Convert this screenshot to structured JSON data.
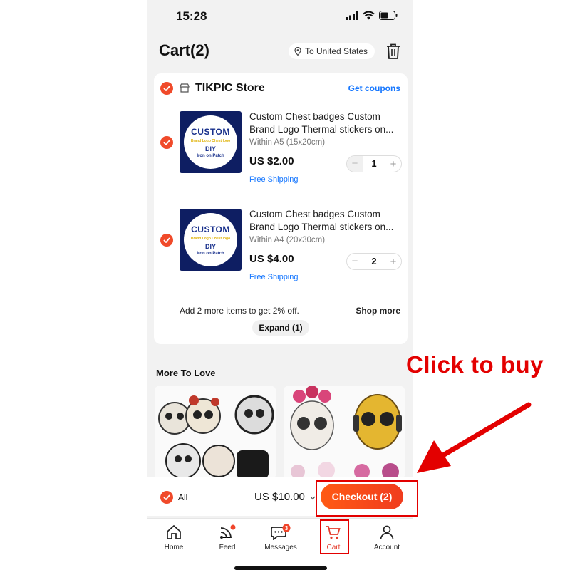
{
  "status_bar": {
    "time": "15:28"
  },
  "header": {
    "title": "Cart(2)",
    "location": "To United States"
  },
  "store": {
    "name": "TIKPIC Store",
    "coupons_label": "Get coupons",
    "items": [
      {
        "thumb": {
          "line1": "CUSTOM",
          "line2": "Brand Logo  Chest logo",
          "line3": "DIY",
          "line4": "Iron on Patch"
        },
        "title_line1": "Custom Chest badges Custom",
        "title_line2": "Brand Logo Thermal stickers on...",
        "variant": "Within A5 (15x20cm)",
        "price": "US $2.00",
        "shipping": "Free Shipping",
        "quantity": "1"
      },
      {
        "thumb": {
          "line1": "CUSTOM",
          "line2": "Brand Logo  Chest logo",
          "line3": "DIY",
          "line4": "Iron on Patch"
        },
        "title_line1": "Custom Chest badges Custom",
        "title_line2": "Brand Logo Thermal stickers on...",
        "variant": "Within A4 (20x30cm)",
        "price": "US $4.00",
        "shipping": "Free Shipping",
        "quantity": "2"
      }
    ],
    "promo": "Add 2 more items to get 2% off.",
    "shop_more": "Shop more",
    "expand": "Expand (1)"
  },
  "more_to_love": {
    "title": "More To Love"
  },
  "bottom_bar": {
    "all_label": "All",
    "total": "US $10.00",
    "checkout": "Checkout (2)"
  },
  "tabs": [
    {
      "label": "Home",
      "icon": "home-icon"
    },
    {
      "label": "Feed",
      "icon": "feed-icon"
    },
    {
      "label": "Messages",
      "icon": "messages-icon",
      "badge": "3"
    },
    {
      "label": "Cart",
      "icon": "cart-icon"
    },
    {
      "label": "Account",
      "icon": "account-icon"
    }
  ],
  "annotation": {
    "text": "Click to buy"
  },
  "colors": {
    "accent": "#f04a2a",
    "link": "#1677ff",
    "annotation": "#e30000"
  }
}
